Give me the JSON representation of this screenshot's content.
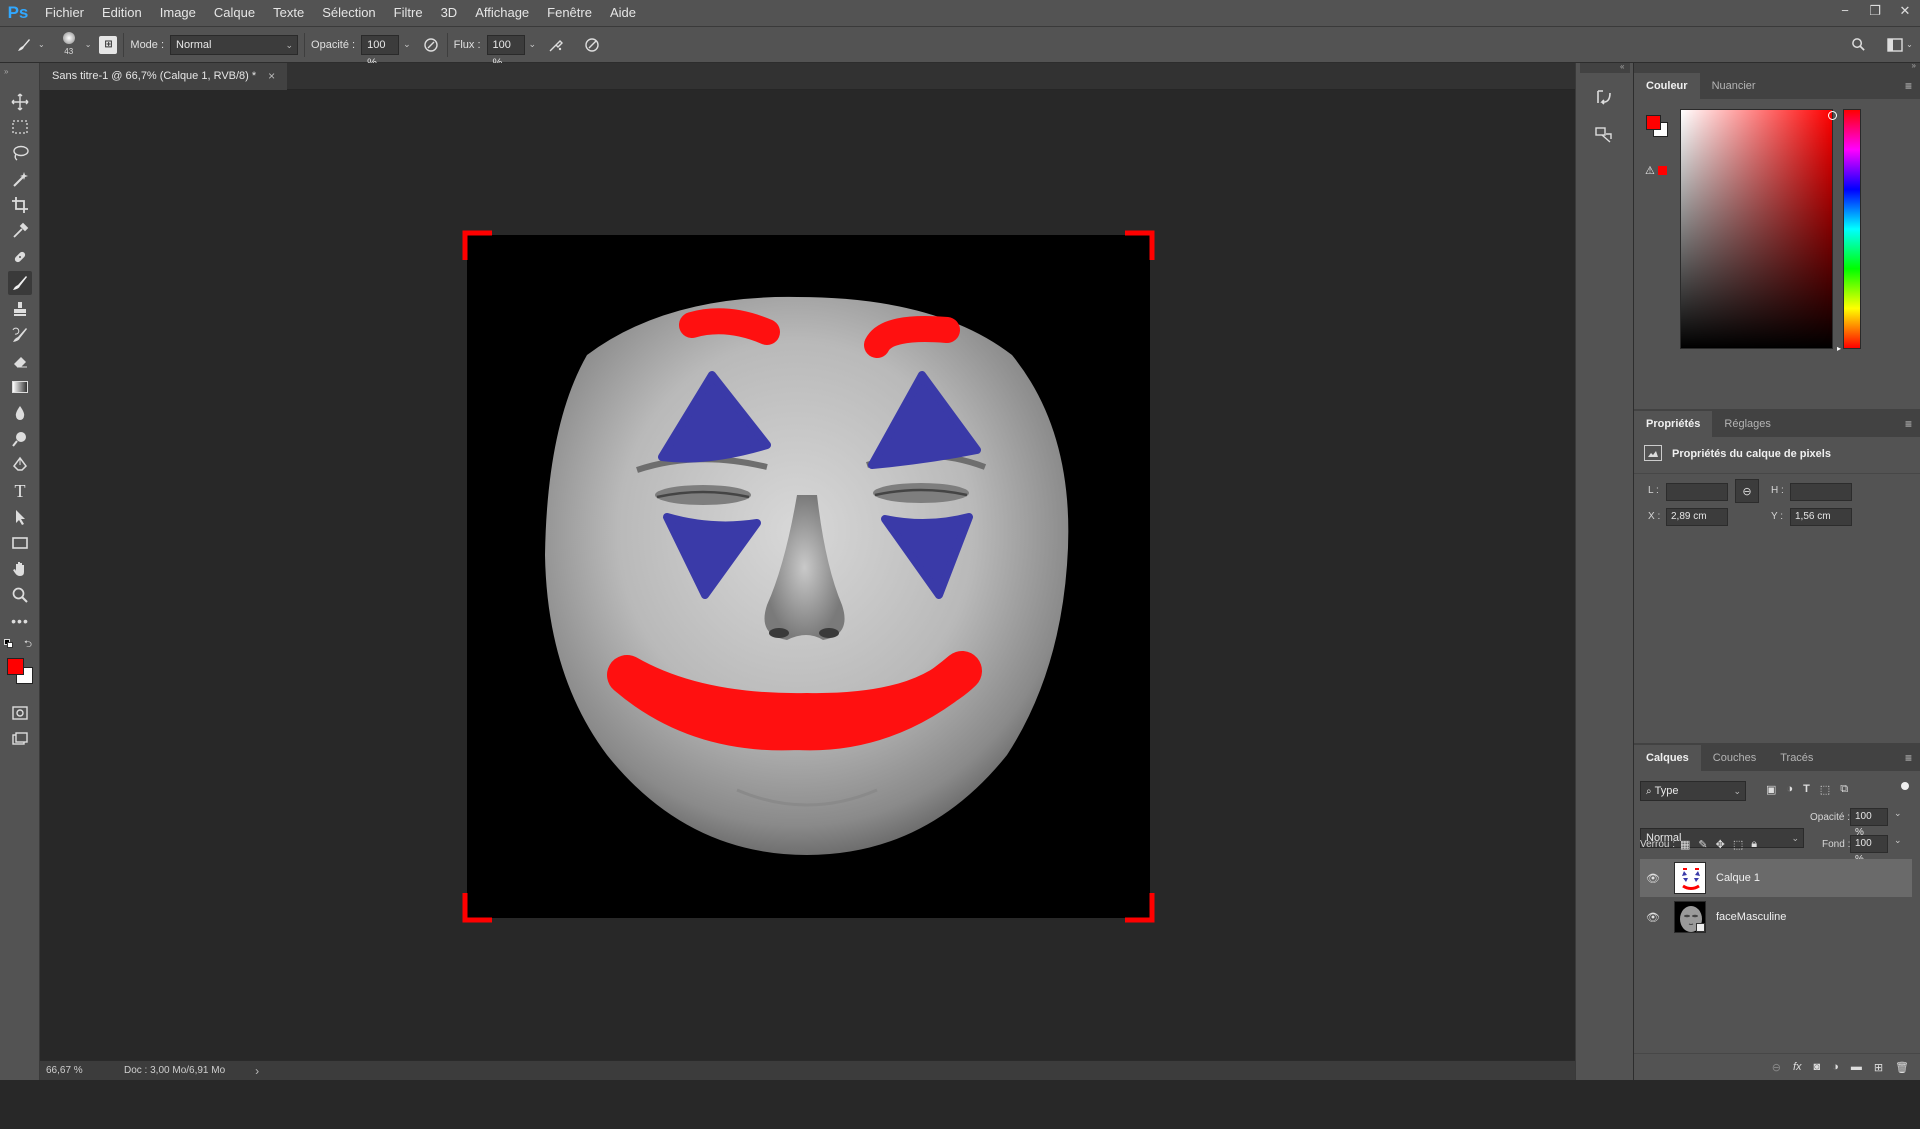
{
  "app": {
    "logo": "Ps",
    "accent": "#31a8ff"
  },
  "menubar": {
    "items": [
      "Fichier",
      "Edition",
      "Image",
      "Calque",
      "Texte",
      "Sélection",
      "Filtre",
      "3D",
      "Affichage",
      "Fenêtre",
      "Aide"
    ]
  },
  "window_controls": {
    "minimize": "−",
    "restore": "❐",
    "close": "✕"
  },
  "options": {
    "brush_size": "43",
    "mode_label": "Mode :",
    "mode_value": "Normal",
    "opacity_label": "Opacité :",
    "opacity_value": "100 %",
    "flow_label": "Flux :",
    "flow_value": "100 %"
  },
  "document": {
    "tab_title": "Sans titre-1 @ 66,7% (Calque 1, RVB/8) *",
    "close": "×"
  },
  "status": {
    "zoom": "66,67 %",
    "doc_info": "Doc : 3,00 Mo/6,91 Mo",
    "arrow": "›"
  },
  "color_panel": {
    "tabs": [
      "Couleur",
      "Nuancier"
    ],
    "foreground": "#ff0000",
    "background": "#ffffff"
  },
  "properties_panel": {
    "tabs": [
      "Propriétés",
      "Réglages"
    ],
    "header": "Propriétés du calque de pixels",
    "w_label": "L :",
    "w_value": "",
    "h_label": "H :",
    "h_value": "",
    "x_label": "X :",
    "x_value": "2,89 cm",
    "y_label": "Y :",
    "y_value": "1,56 cm"
  },
  "layers_panel": {
    "tabs": [
      "Calques",
      "Couches",
      "Tracés"
    ],
    "filter": "Type",
    "blend_mode": "Normal",
    "opacity_label": "Opacité :",
    "opacity_value": "100 %",
    "lock_label": "Verrou :",
    "fill_label": "Fond :",
    "fill_value": "100 %",
    "layers": [
      {
        "name": "Calque 1",
        "selected": true
      },
      {
        "name": "faceMasculine",
        "selected": false
      }
    ]
  },
  "paint_colors": {
    "red": "#ff1010",
    "blue": "#3a3aa8"
  }
}
